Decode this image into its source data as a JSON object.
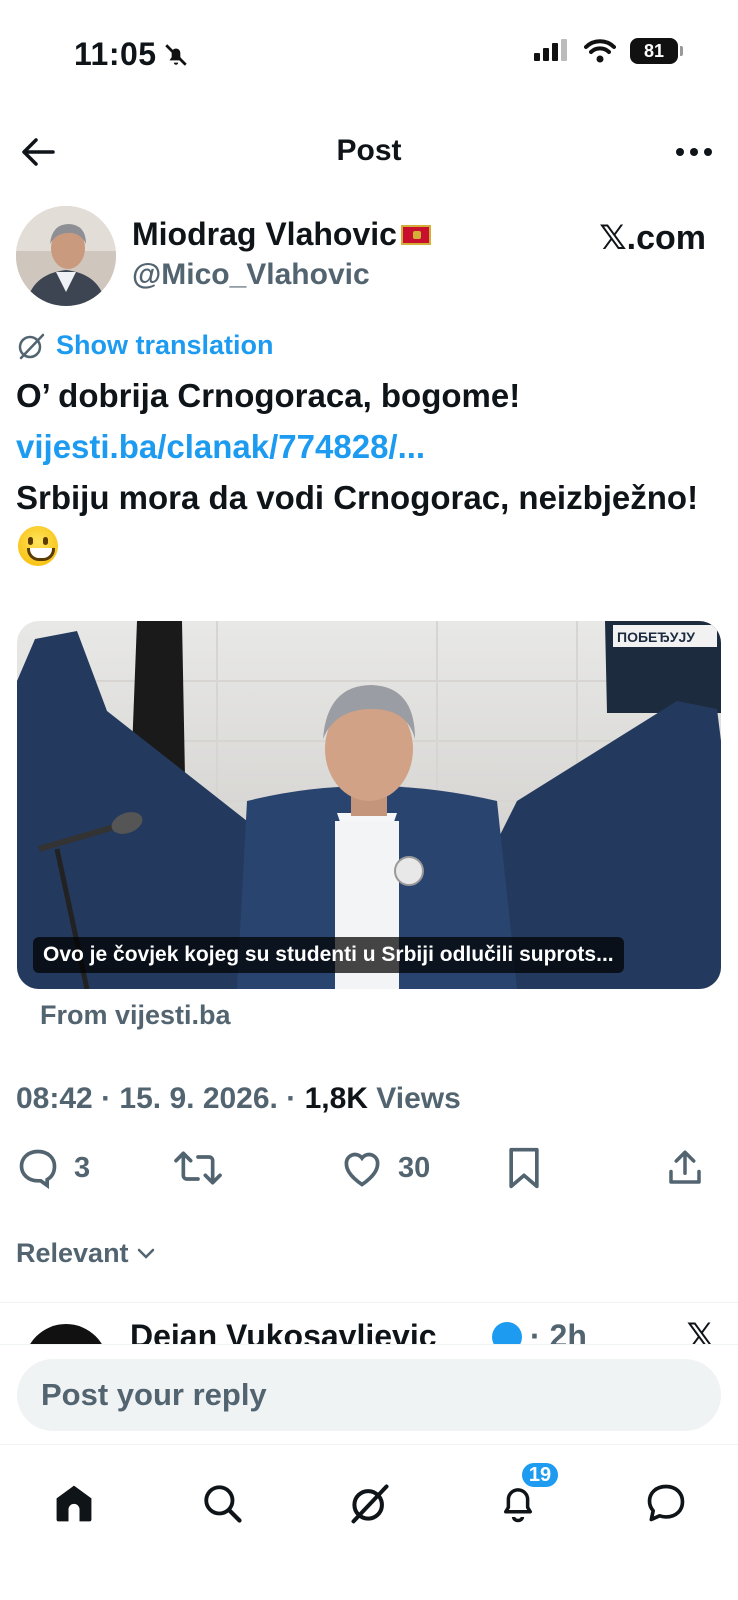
{
  "status_bar": {
    "time": "11:05",
    "battery": "81"
  },
  "header": {
    "title": "Post"
  },
  "author": {
    "name": "Miodrag Vlahovic",
    "handle": "@Mico_Vlahovic",
    "source_label": "𝕏.com"
  },
  "translation": {
    "label": "Show translation"
  },
  "post": {
    "line1": "O’ dobrija Crnogoraca, bogome!",
    "link": "vijesti.ba/clanak/774828/...",
    "line2": "Srbiju mora da vodi Crnogorac, neizbježno!"
  },
  "media": {
    "caption": "Ovo je čovjek kojeg su studenti u Srbiji odlučili suprots...",
    "sign_text": "ПОБЕЂУЈУ",
    "from": "From vijesti.ba"
  },
  "meta": {
    "time": "08:42",
    "date": "15. 9. 2026.",
    "views_count": "1,8K",
    "views_label": "Views",
    "separator": "·"
  },
  "actions": {
    "replies": "3",
    "likes": "30"
  },
  "sort": {
    "label": "Relevant"
  },
  "reply_peek": {
    "name": "Dejan Vukosavljevic",
    "time": "· 2h",
    "source": "𝕏"
  },
  "composer": {
    "placeholder": "Post your reply"
  },
  "nav": {
    "notifications_badge": "19"
  },
  "colors": {
    "accent": "#1d9bf0",
    "text": "#0f1419",
    "secondary": "#536471"
  }
}
